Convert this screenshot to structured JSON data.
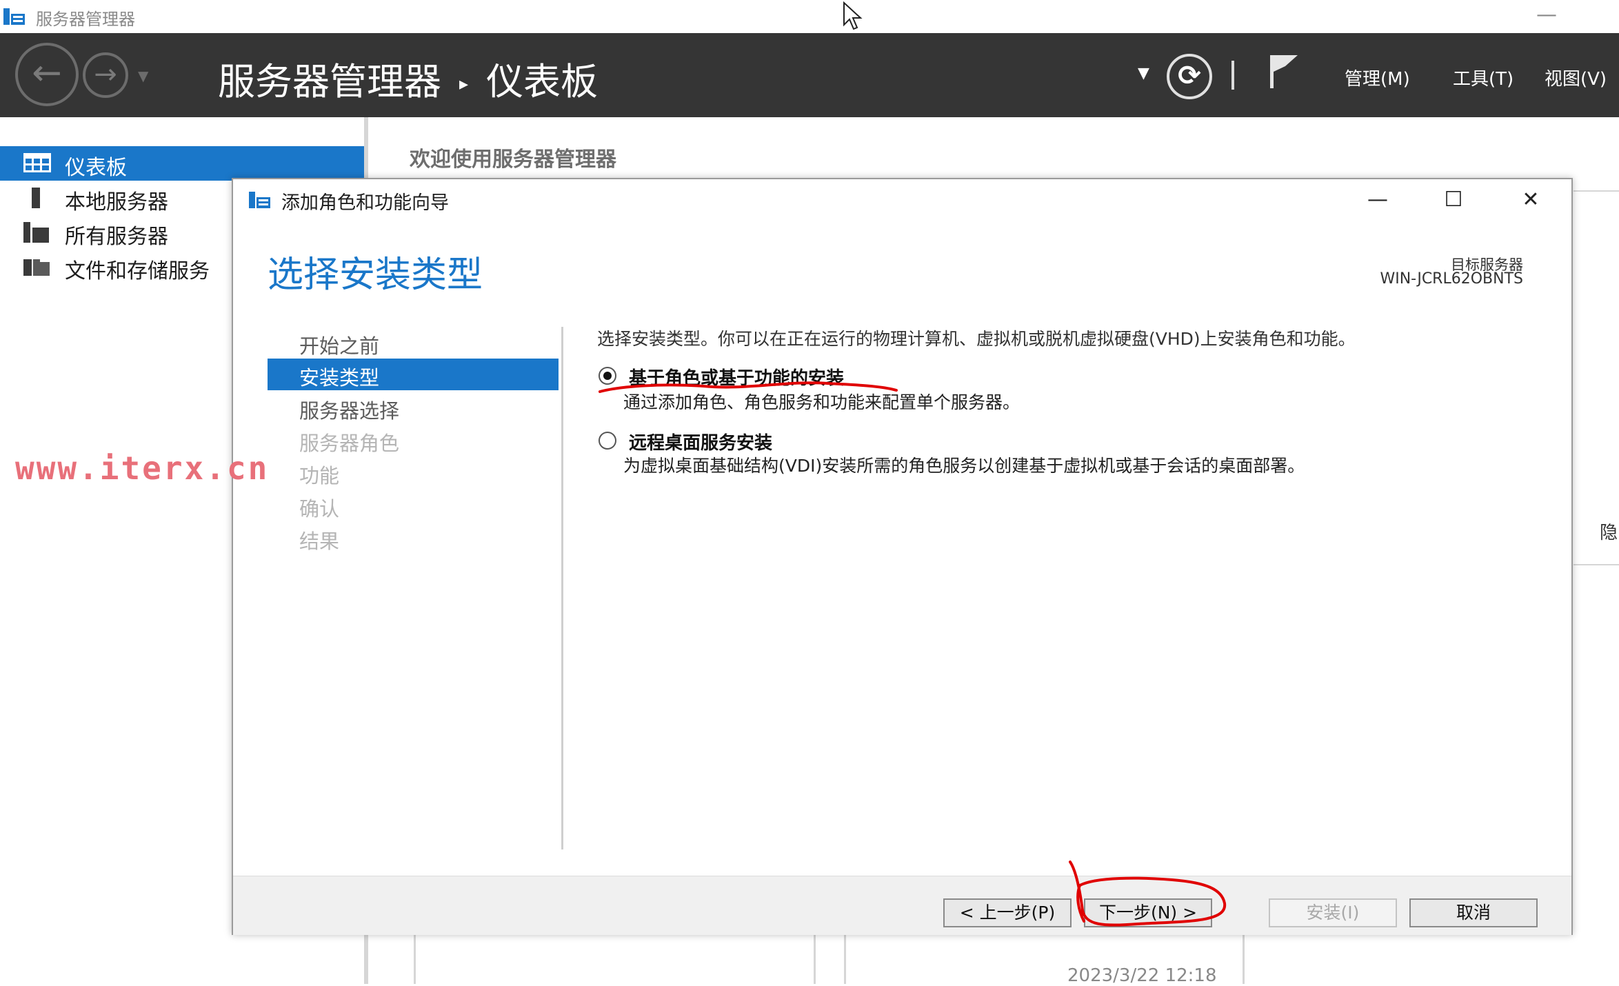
{
  "app": {
    "window_title": "服务器管理器"
  },
  "header": {
    "breadcrumb_root": "服务器管理器",
    "breadcrumb_sep": "▸",
    "breadcrumb_page": "仪表板",
    "menus": [
      "管理(M)",
      "工具(T)",
      "视图(V)"
    ]
  },
  "sidebar": {
    "items": [
      {
        "label": "仪表板",
        "icon": "dashboard-icon",
        "active": true
      },
      {
        "label": "本地服务器",
        "icon": "local-server-icon",
        "active": false
      },
      {
        "label": "所有服务器",
        "icon": "all-servers-icon",
        "active": false
      },
      {
        "label": "文件和存储服务",
        "icon": "file-storage-icon",
        "active": false
      }
    ]
  },
  "main": {
    "welcome": "欢迎使用服务器管理器",
    "date_fragment": "2023/3/22 12:18",
    "hidden_fragment": "隐"
  },
  "dialog": {
    "title": "添加角色和功能向导",
    "heading": "选择安装类型",
    "target_label": "目标服务器",
    "target_value": "WIN-JCRL62OBNTS",
    "steps": [
      {
        "label": "开始之前",
        "state": "normal"
      },
      {
        "label": "安装类型",
        "state": "active"
      },
      {
        "label": "服务器选择",
        "state": "normal"
      },
      {
        "label": "服务器角色",
        "state": "disabled"
      },
      {
        "label": "功能",
        "state": "disabled"
      },
      {
        "label": "确认",
        "state": "disabled"
      },
      {
        "label": "结果",
        "state": "disabled"
      }
    ],
    "description": "选择安装类型。你可以在正在运行的物理计算机、虚拟机或脱机虚拟硬盘(VHD)上安装角色和功能。",
    "options": [
      {
        "title": "基于角色或基于功能的安装",
        "desc": "通过添加角色、角色服务和功能来配置单个服务器。",
        "selected": true
      },
      {
        "title": "远程桌面服务安装",
        "desc": "为虚拟桌面基础结构(VDI)安装所需的角色服务以创建基于虚拟机或基于会话的桌面部署。",
        "selected": false
      }
    ],
    "buttons": {
      "prev": "< 上一步(P)",
      "next": "下一步(N) >",
      "install": "安装(I)",
      "cancel": "取消"
    }
  },
  "watermark": "www.iterx.cn",
  "colors": {
    "accent": "#1a77c9",
    "header_bg": "#353535",
    "annotation": "#e00000",
    "watermark": "#e8707a"
  }
}
